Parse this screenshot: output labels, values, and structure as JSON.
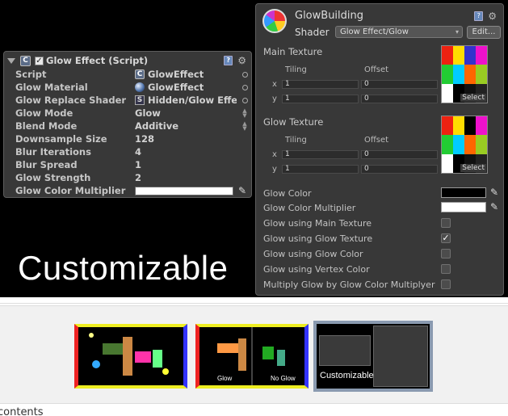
{
  "left_panel": {
    "title": "Glow Effect (Script)",
    "rows": [
      {
        "label": "Script",
        "value": "GlowEffect"
      },
      {
        "label": "Glow Material",
        "value": "GlowEffect"
      },
      {
        "label": "Glow Replace Shader",
        "value": "Hidden/Glow Effect"
      },
      {
        "label": "Glow Mode",
        "value": "Glow"
      },
      {
        "label": "Blend Mode",
        "value": "Additive"
      },
      {
        "label": "Downsample Size",
        "value": "128"
      },
      {
        "label": "Blur Iterations",
        "value": "4"
      },
      {
        "label": "Blur Spread",
        "value": "1"
      },
      {
        "label": "Glow Strength",
        "value": "2"
      },
      {
        "label": "Glow Color Multiplier",
        "value": ""
      }
    ]
  },
  "overlay_text": "Customizable",
  "right_panel": {
    "material_name": "GlowBuilding",
    "shader_label": "Shader",
    "shader_value": "Glow Effect/Glow",
    "edit_label": "Edit...",
    "main_texture": {
      "title": "Main Texture",
      "tiling": "Tiling",
      "offset": "Offset",
      "x": "x",
      "y": "y",
      "tx": "1",
      "ty": "1",
      "ox": "0",
      "oy": "0",
      "select": "Select"
    },
    "glow_texture": {
      "title": "Glow Texture",
      "tiling": "Tiling",
      "offset": "Offset",
      "x": "x",
      "y": "y",
      "tx": "1",
      "ty": "1",
      "ox": "0",
      "oy": "0",
      "select": "Select"
    },
    "props": [
      {
        "label": "Glow Color",
        "kind": "color",
        "color": "#000000"
      },
      {
        "label": "Glow Color Multiplier",
        "kind": "color",
        "color": "#ffffff"
      },
      {
        "label": "Glow using Main Texture",
        "kind": "toggle",
        "checked": false
      },
      {
        "label": "Glow using Glow Texture",
        "kind": "toggle",
        "checked": true
      },
      {
        "label": "Glow using Glow Color",
        "kind": "toggle",
        "checked": false
      },
      {
        "label": "Glow using Vertex Color",
        "kind": "toggle",
        "checked": false
      },
      {
        "label": "Multiply Glow by Glow Color Multiplyer",
        "kind": "toggle",
        "checked": false
      }
    ]
  },
  "thumbnails": [
    {
      "caption": ""
    },
    {
      "caption_left": "Glow",
      "caption_right": "No Glow"
    },
    {
      "caption": "Customizable"
    }
  ],
  "footer_text": "contents"
}
